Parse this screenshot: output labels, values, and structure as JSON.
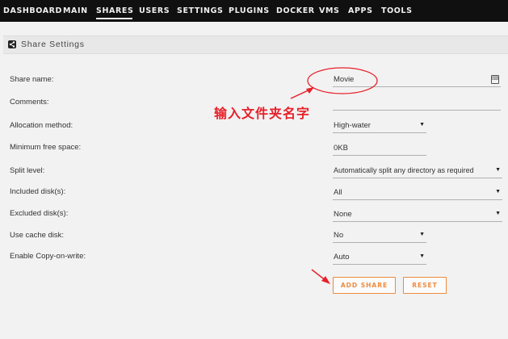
{
  "nav": {
    "items": [
      {
        "label": "DASHBOARD"
      },
      {
        "label": "MAIN"
      },
      {
        "label": "SHARES",
        "active": true
      },
      {
        "label": "USERS"
      },
      {
        "label": "SETTINGS"
      },
      {
        "label": "PLUGINS"
      },
      {
        "label": "DOCKER"
      },
      {
        "label": "VMS"
      },
      {
        "label": "APPS"
      },
      {
        "label": "TOOLS"
      }
    ]
  },
  "section": {
    "title": "Share Settings",
    "icon": "share-icon"
  },
  "form": {
    "share_name": {
      "label": "Share name:",
      "value": "Movie"
    },
    "comments": {
      "label": "Comments:",
      "value": ""
    },
    "allocation_method": {
      "label": "Allocation method:",
      "value": "High-water"
    },
    "minimum_free_space": {
      "label": "Minimum free space:",
      "value": "0KB"
    },
    "split_level": {
      "label": "Split level:",
      "value": "Automatically split any directory as required"
    },
    "included_disks": {
      "label": "Included disk(s):",
      "value": "All"
    },
    "excluded_disks": {
      "label": "Excluded disk(s):",
      "value": "None"
    },
    "use_cache_disk": {
      "label": "Use cache disk:",
      "value": "No"
    },
    "copy_on_write": {
      "label": "Enable Copy-on-write:",
      "value": "Auto"
    }
  },
  "buttons": {
    "add_share": "ADD SHARE",
    "reset": "RESET"
  },
  "annotation": {
    "text": "输入文件夹名字",
    "color": "#e8202a"
  },
  "colors": {
    "accent": "#f08a3c",
    "nav_bg": "#101010"
  }
}
